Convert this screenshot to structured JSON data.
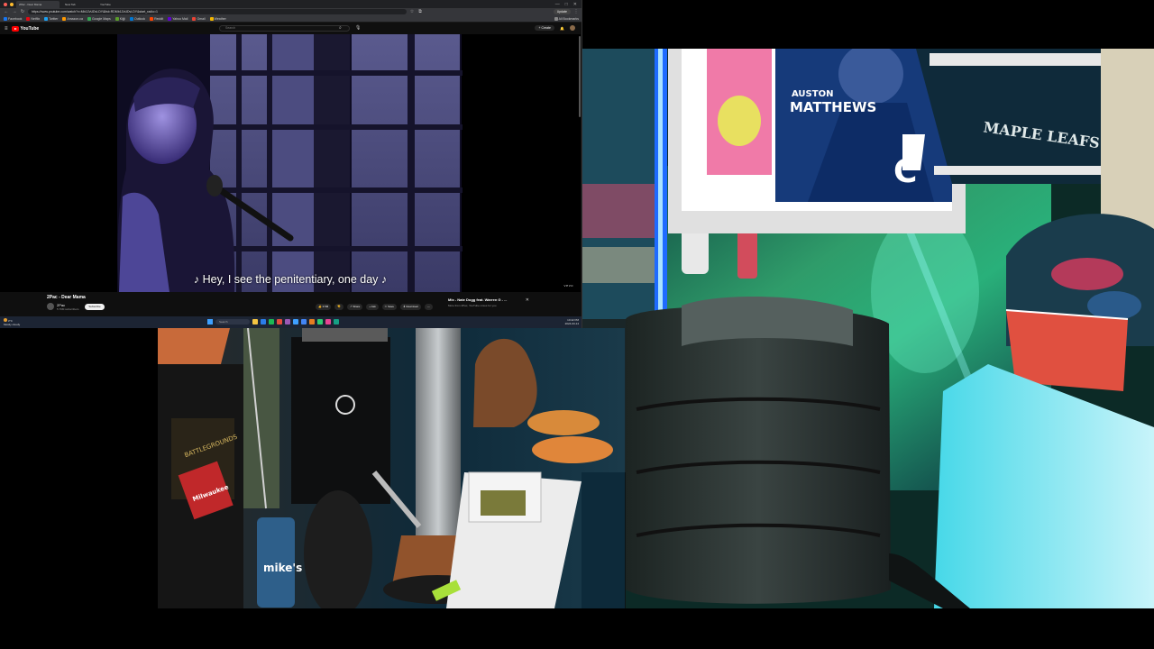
{
  "browser": {
    "tabs": [
      "2Pac - Dear Mama",
      "New Tab",
      "YouTube"
    ],
    "url": "https://www.youtube.com/watch?v=Mb1ZvUDvLDY&list=RDMb1ZvUDvLDY&start_radio=1",
    "profile_label": "Update",
    "bookmarks": [
      "Facebook",
      "Netflix",
      "Twitter",
      "Amazon.ca",
      "Google Maps",
      "Kijiji",
      "Outlook",
      "Reddit",
      "Yahoo Mail",
      "Gmail",
      "Weather",
      "All Bookmarks"
    ]
  },
  "youtube": {
    "logo": "YouTube",
    "search_placeholder": "Search",
    "create_label": "+ Create",
    "subtitle": "♪ Hey, I see the penitentiary, one day ♪",
    "watermark": "vevo",
    "video_title": "2Pac - Dear Mama",
    "channel": "2Pac",
    "subscribers": "5.79M subscribers",
    "subscribe_label": "Subscribe",
    "actions": [
      "👍 3.5M",
      "👎",
      "↗ Share",
      "+ Ask",
      "✂ Save",
      "⬇ Download",
      "⋯"
    ],
    "mix_title": "Mix - Nate Dogg feat. Warren G - ...",
    "mix_subtitle": "More from 2Pac, YouTube mixes for you",
    "colors": {
      "brand": "#ff0000",
      "background": "#0f0f0f"
    }
  },
  "taskbar": {
    "weather_temp": "3°C",
    "weather_desc": "Mostly cloudy",
    "search_placeholder": "Search",
    "time": "10:42 PM",
    "date": "2024-03-14"
  },
  "room": {
    "poster_name": "AUSTON",
    "poster_surname": "MATTHEWS",
    "jersey_text": "MAPLE LEAFS",
    "jersey_captain": "C"
  },
  "desk": {
    "book_title": "BATTLEGROUNDS",
    "bag_brand": "Milwaukee",
    "can_brand": "mike's"
  }
}
